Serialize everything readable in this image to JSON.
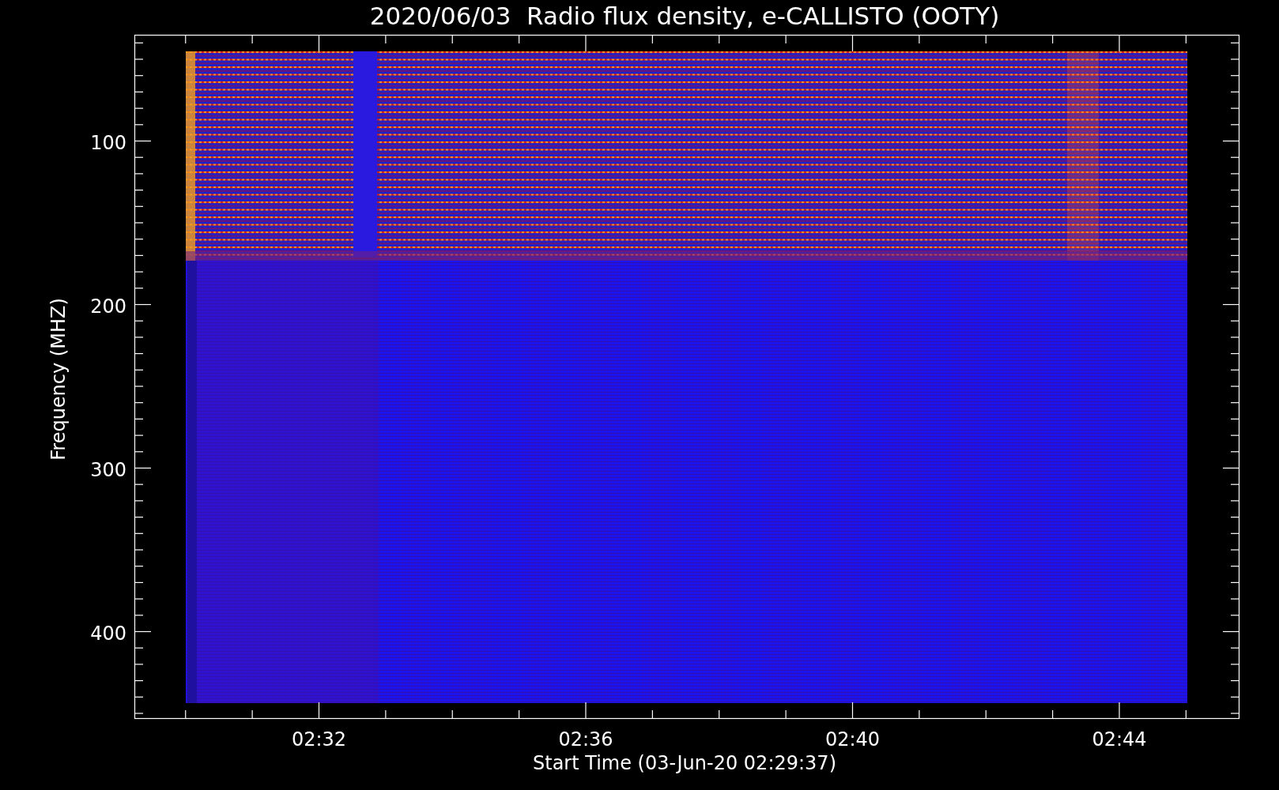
{
  "title": "2020/06/03  Radio flux density, e-CALLISTO (OOTY)",
  "plot": {
    "ylabel": "Frequency (MHZ)",
    "xlabel": "Start Time (03-Jun-20 02:29:37)",
    "y_ticks": [
      "100",
      "200",
      "300",
      "400"
    ],
    "x_ticks": [
      "02:32",
      "02:36",
      "02:40",
      "02:44"
    ]
  }
}
